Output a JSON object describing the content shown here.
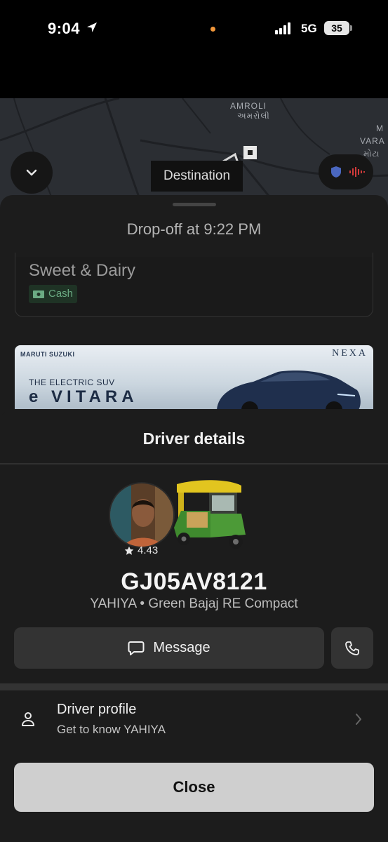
{
  "status_bar": {
    "time": "9:04",
    "network": "5G",
    "battery": "35"
  },
  "map": {
    "labels": [
      "AMROLI",
      "અમરોલી",
      "M",
      "VARA",
      "મોટા"
    ],
    "destination_tag": "Destination"
  },
  "trip": {
    "dropoff": "Drop-off at 9:22 PM",
    "store_name": "Sweet & Dairy",
    "payment": "Cash"
  },
  "ad": {
    "brand": "MARUTI SUZUKI",
    "nexa": "NEXA",
    "tagline": "THE ELECTRIC SUV",
    "model": "e VITARA"
  },
  "driver_details": {
    "title": "Driver details",
    "rating": "4.43",
    "plate": "GJ05AV8121",
    "vehicle_desc": "YAHIYA • Green Bajaj RE Compact",
    "message_label": "Message"
  },
  "driver_profile": {
    "title": "Driver profile",
    "subtitle": "Get to know YAHIYA"
  },
  "close_label": "Close",
  "colors": {
    "background": "#1c1c1c",
    "button": "#333333",
    "close_button": "#cfcfcf",
    "accent_orange": "#f2973a",
    "cash_green": "#6bab83"
  }
}
